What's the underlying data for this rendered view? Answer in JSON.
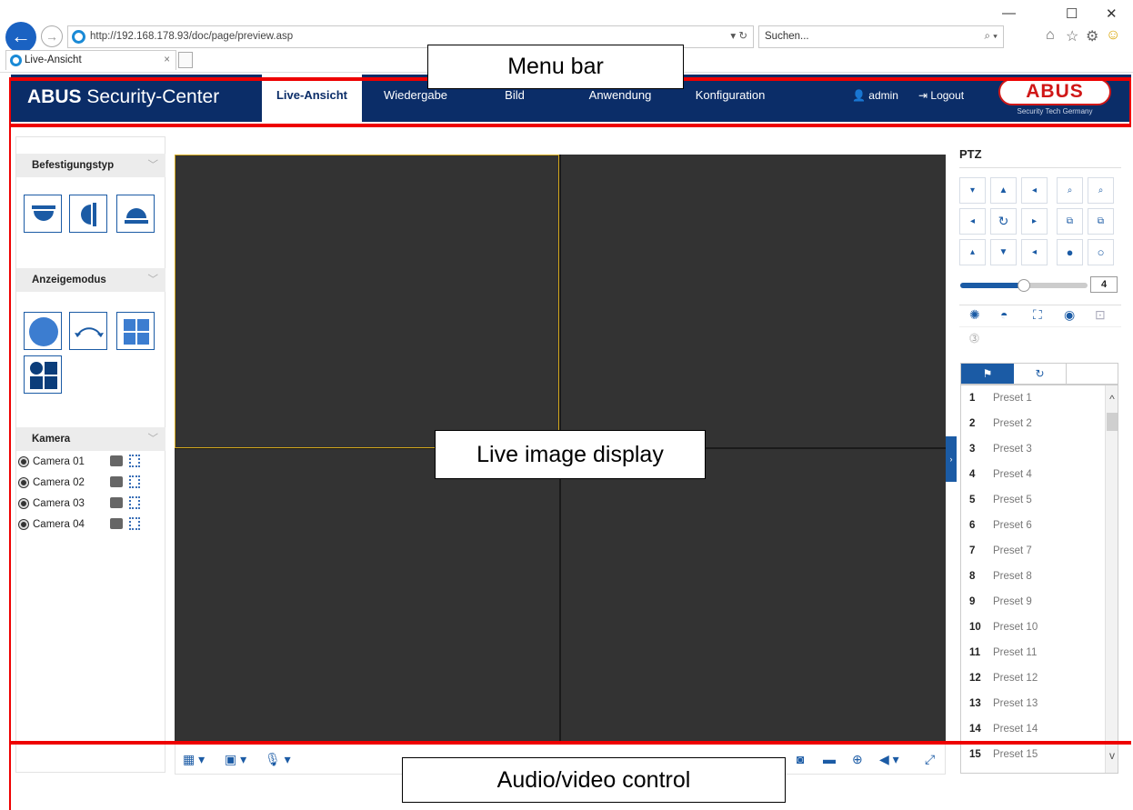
{
  "browser": {
    "url": "http://192.168.178.93/doc/page/preview.asp",
    "url_controls": "▾ ↻",
    "search_placeholder": "Suchen...",
    "search_controls": "⌕ ▾",
    "tab_title": "Live-Ansicht",
    "tab_close": "×",
    "window_minimize": "—",
    "window_maximize": "☐",
    "window_close": "✕",
    "tools": [
      "⌂",
      "☆",
      "⚙",
      "☺"
    ]
  },
  "header": {
    "brand_bold": "ABUS",
    "brand_rest": " Security-Center",
    "menu": [
      "Live-Ansicht",
      "Wiedergabe",
      "Bild",
      "Anwendung",
      "Konfiguration"
    ],
    "active_menu": "Live-Ansicht",
    "user": "admin",
    "logout": "Logout",
    "logo_text": "ABUS",
    "logo_tagline": "Security Tech Germany"
  },
  "left_panel": {
    "mount_type_title": "Befestigungstyp",
    "display_mode_title": "Anzeigemodus",
    "camera_title": "Kamera",
    "cameras": [
      "Camera 01",
      "Camera 02",
      "Camera 03",
      "Camera 04"
    ]
  },
  "ptz": {
    "title": "PTZ",
    "speed_value": "4",
    "speed_fraction": 0.5,
    "presets": [
      {
        "num": "1",
        "label": "Preset 1"
      },
      {
        "num": "2",
        "label": "Preset 2"
      },
      {
        "num": "3",
        "label": "Preset 3"
      },
      {
        "num": "4",
        "label": "Preset 4"
      },
      {
        "num": "5",
        "label": "Preset 5"
      },
      {
        "num": "6",
        "label": "Preset 6"
      },
      {
        "num": "7",
        "label": "Preset 7"
      },
      {
        "num": "8",
        "label": "Preset 8"
      },
      {
        "num": "9",
        "label": "Preset 9"
      },
      {
        "num": "10",
        "label": "Preset 10"
      },
      {
        "num": "11",
        "label": "Preset 11"
      },
      {
        "num": "12",
        "label": "Preset 12"
      },
      {
        "num": "13",
        "label": "Preset 13"
      },
      {
        "num": "14",
        "label": "Preset 14"
      },
      {
        "num": "15",
        "label": "Preset 15"
      }
    ]
  },
  "annotations": {
    "menu_bar": "Menu bar",
    "live_image": "Live image display",
    "av_control": "Audio/video control"
  },
  "colors": {
    "header_bg": "#0b2d68",
    "accent": "#1b5ba5",
    "annotation": "#e00000",
    "logo_red": "#d01818"
  }
}
